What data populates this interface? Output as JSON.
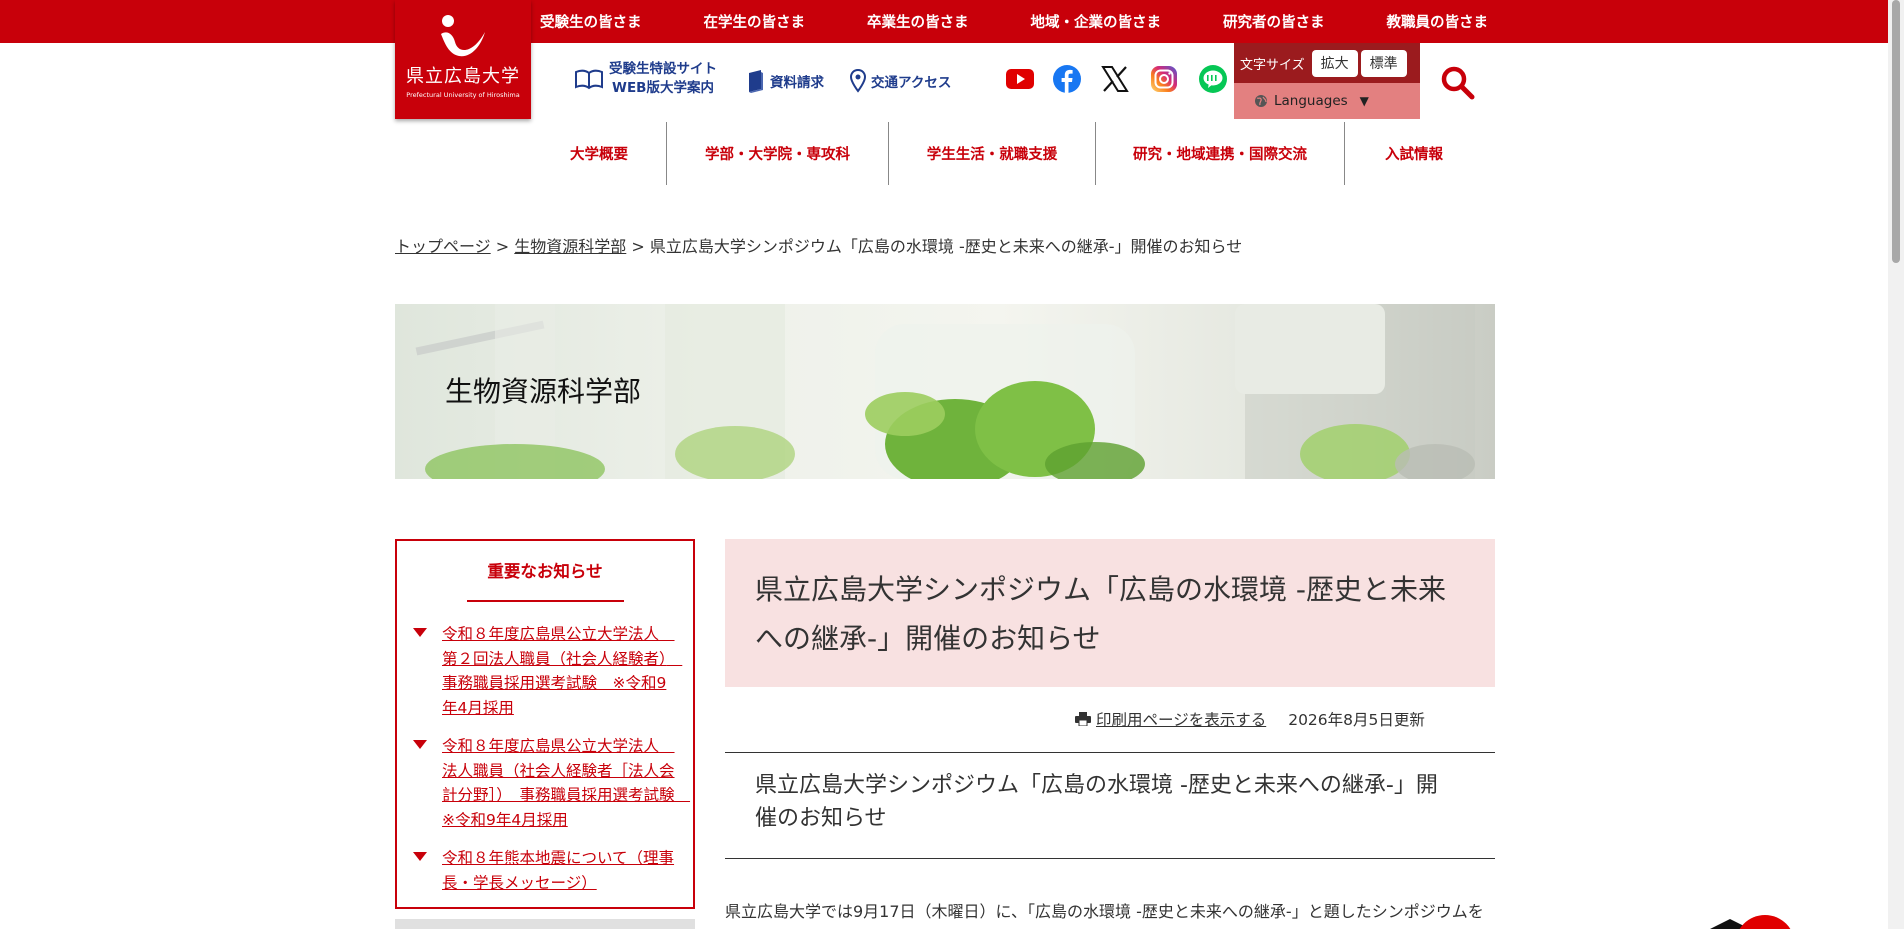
{
  "audience_nav": [
    "受験生の皆さま",
    "在学生の皆さま",
    "卒業生の皆さま",
    "地域・企業の皆さま",
    "研究者の皆さま",
    "教職員の皆さま"
  ],
  "logo": {
    "title": "県立広島大学",
    "subtitle": "Prefectural University of Hiroshima"
  },
  "utility": {
    "exam_site_line1": "受験生特設サイト",
    "exam_site_line2": "WEB版大学案内",
    "materials": "資料請求",
    "access": "交通アクセス"
  },
  "sns": [
    "youtube-icon",
    "facebook-icon",
    "x-icon",
    "instagram-icon",
    "line-icon"
  ],
  "font_size": {
    "label": "文字サイズ",
    "enlarge": "拡大",
    "standard": "標準"
  },
  "languages": {
    "label": "Languages",
    "caret": "▼"
  },
  "global_nav": [
    "大学概要",
    "学部・大学院・専攻科",
    "学生生活・就職支援",
    "研究・地域連携・国際交流",
    "入試情報"
  ],
  "breadcrumb": {
    "home": "トップページ",
    "sep": ">",
    "section": "生物資源科学部",
    "current": "県立広島大学シンポジウム「広島の水環境 -歴史と未来への継承-」開催のお知らせ"
  },
  "banner": {
    "title": "生物資源科学部"
  },
  "notices": {
    "title": "重要なお知らせ",
    "items": [
      "令和８年度広島県公立大学法人　第２回法人職員（社会人経験者）　事務職員採用選考試験　※令和9年4月採用",
      "令和８年度広島県公立大学法人　法人職員（社会人経験者［法人会計分野］）　事務職員採用選考試験　※令和9年4月採用",
      "令和８年熊本地震について（理事長・学長メッセージ）"
    ]
  },
  "article": {
    "title": "県立広島大学シンポジウム「広島の水環境 -歴史と未来への継承-」開催のお知らせ",
    "print_link": "印刷用ページを表示する",
    "updated": "2026年8月5日更新",
    "subtitle": "県立広島大学シンポジウム「広島の水環境 -歴史と未来への継承-」開催のお知らせ",
    "body_start": "県立広島大学では9月17日（木曜日）に、「広島の水環境 -歴史と未来への継承-」と題したシンポジウムを"
  },
  "colors": {
    "brand_red": "#c8000a",
    "nav_blue": "#1f3c8c",
    "title_bg": "#f8e1e1"
  }
}
